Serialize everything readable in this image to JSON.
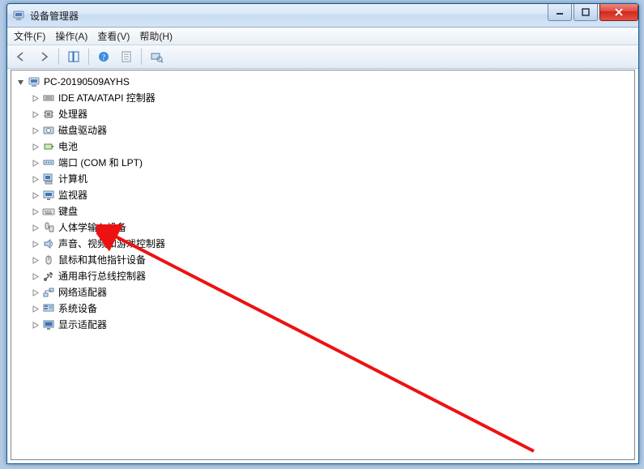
{
  "window": {
    "title": "设备管理器"
  },
  "menu": {
    "file": "文件(F)",
    "action": "操作(A)",
    "view": "查看(V)",
    "help": "帮助(H)"
  },
  "tree": {
    "root": {
      "label": "PC-20190509AYHS",
      "expanded": true
    },
    "items": [
      {
        "label": "IDE ATA/ATAPI 控制器",
        "icon": "ide"
      },
      {
        "label": "处理器",
        "icon": "cpu"
      },
      {
        "label": "磁盘驱动器",
        "icon": "disk"
      },
      {
        "label": "电池",
        "icon": "battery"
      },
      {
        "label": "端口 (COM 和 LPT)",
        "icon": "port"
      },
      {
        "label": "计算机",
        "icon": "computer"
      },
      {
        "label": "监视器",
        "icon": "monitor"
      },
      {
        "label": "键盘",
        "icon": "keyboard"
      },
      {
        "label": "人体学输入设备",
        "icon": "hid"
      },
      {
        "label": "声音、视频和游戏控制器",
        "icon": "audio"
      },
      {
        "label": "鼠标和其他指针设备",
        "icon": "mouse"
      },
      {
        "label": "通用串行总线控制器",
        "icon": "usb"
      },
      {
        "label": "网络适配器",
        "icon": "network"
      },
      {
        "label": "系统设备",
        "icon": "system"
      },
      {
        "label": "显示适配器",
        "icon": "display"
      }
    ]
  }
}
